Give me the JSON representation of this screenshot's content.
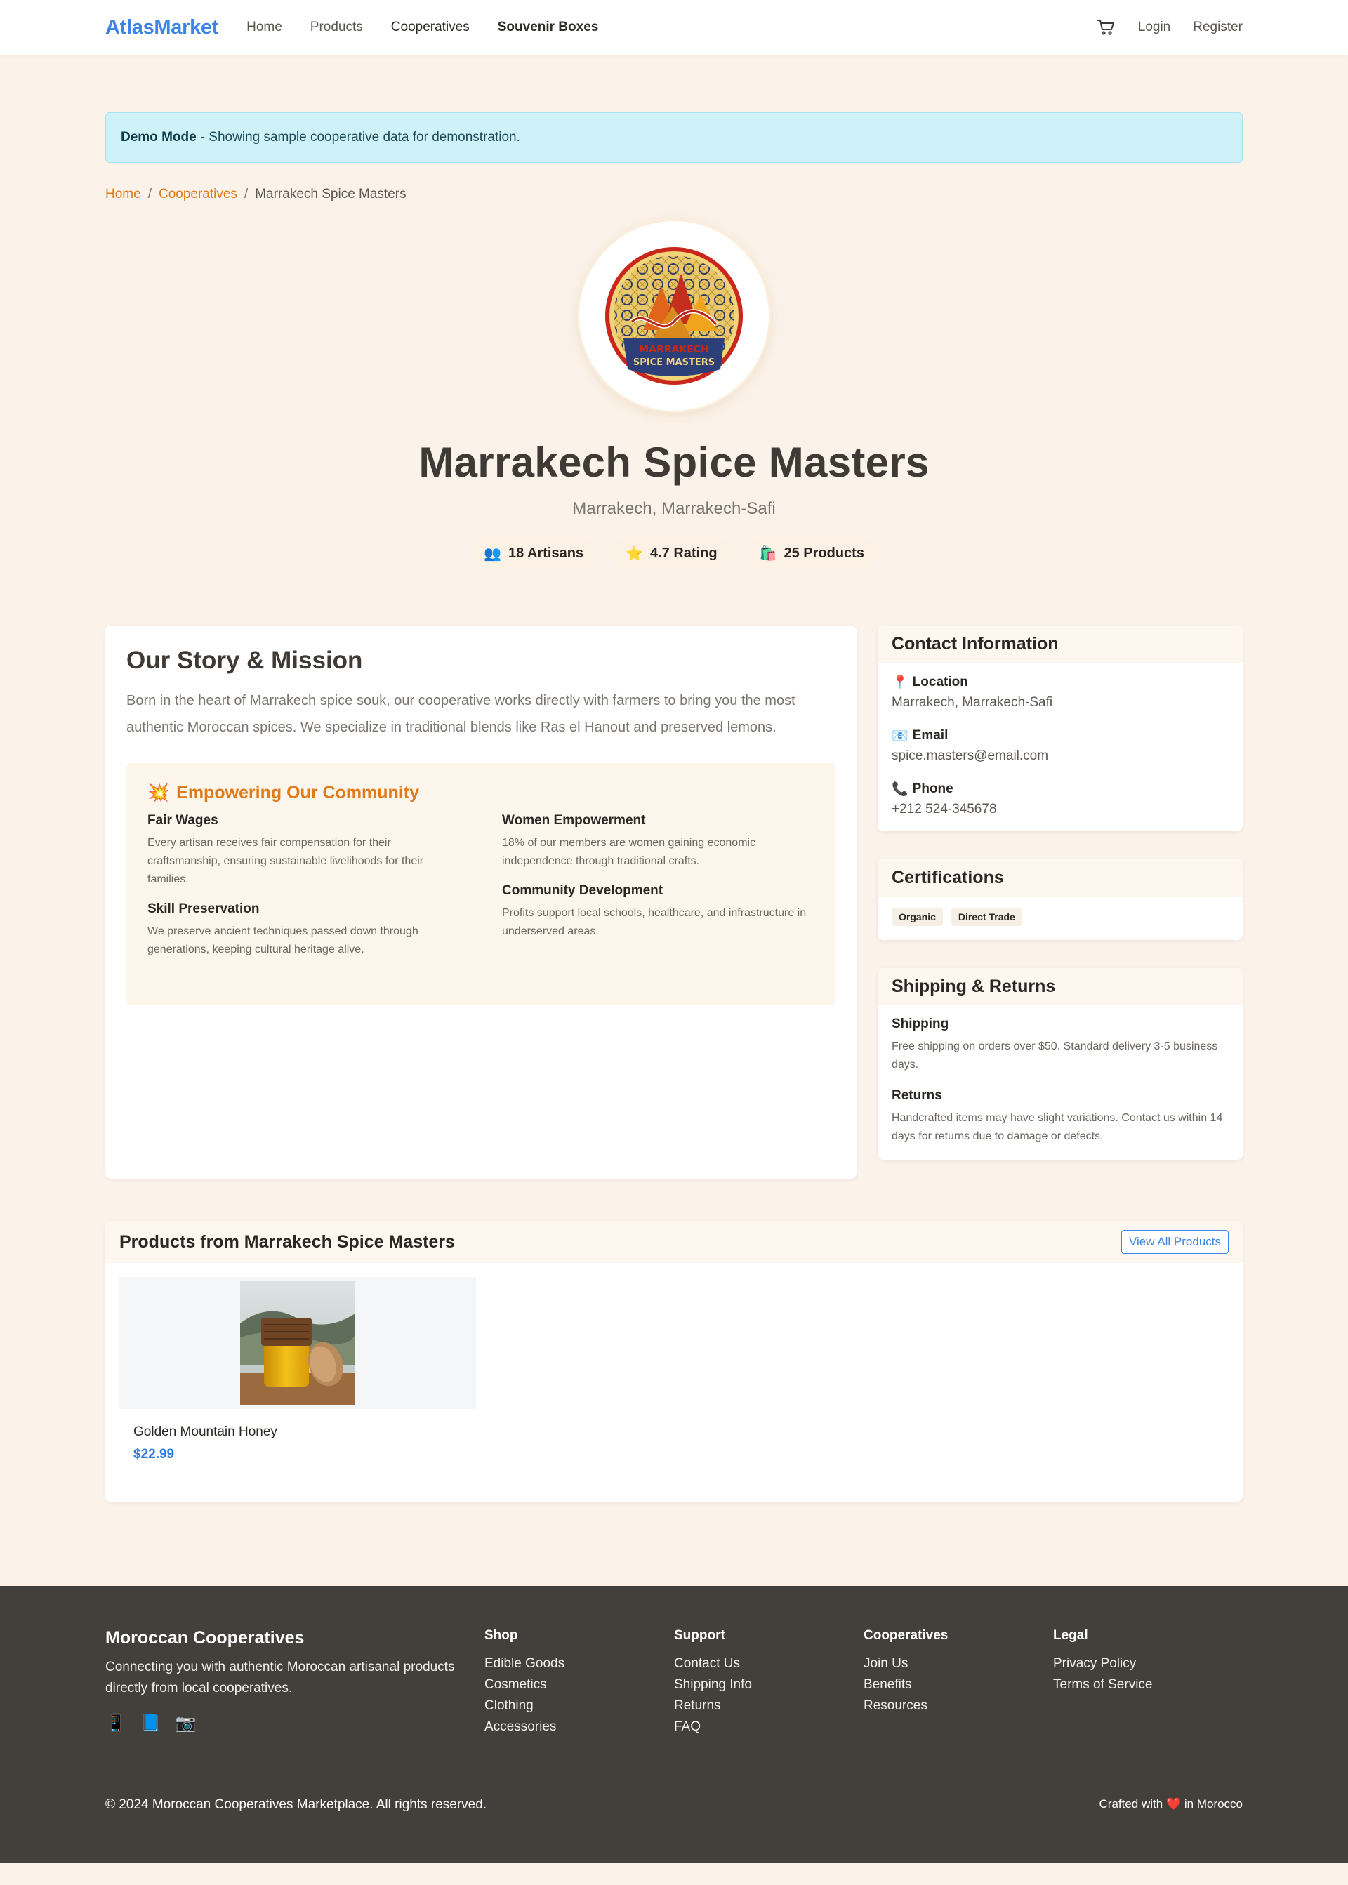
{
  "nav": {
    "brand": "AtlasMarket",
    "links": [
      "Home",
      "Products",
      "Cooperatives",
      "Souvenir Boxes"
    ],
    "login": "Login",
    "register": "Register",
    "cart_icon": "cart-icon"
  },
  "alert": {
    "title": "Demo Mode",
    "text": "- Showing sample cooperative data for demonstration."
  },
  "breadcrumb": {
    "home": "Home",
    "cooperatives": "Cooperatives",
    "current": "Marrakech Spice Masters"
  },
  "cooperative": {
    "name": "Marrakech Spice Masters",
    "location": "Marrakech, Marrakech-Safi",
    "logo_text_1": "MARRAKECH",
    "logo_text_2": "SPICE MASTERS",
    "stats": [
      {
        "icon": "👥",
        "label": "18 Artisans"
      },
      {
        "icon": "⭐",
        "label": "4.7 Rating"
      },
      {
        "icon": "🛍️",
        "label": "25 Products"
      }
    ]
  },
  "story": {
    "title": "Our Story & Mission",
    "text": "Born in the heart of Marrakech spice souk, our cooperative works directly with farmers to bring you the most authentic Moroccan spices. We specialize in traditional blends like Ras el Hanout and preserved lemons.",
    "empower_icon": "💥",
    "empower_title": "Empowering Our Community",
    "items": [
      {
        "title": "Fair Wages",
        "text": "Every artisan receives fair compensation for their craftsmanship, ensuring sustainable livelihoods for their families."
      },
      {
        "title": "Women Empowerment",
        "text": "18% of our members are women gaining economic independence through traditional crafts."
      },
      {
        "title": "Skill Preservation",
        "text": "We preserve ancient techniques passed down through generations, keeping cultural heritage alive."
      },
      {
        "title": "Community Development",
        "text": "Profits support local schools, healthcare, and infrastructure in underserved areas."
      }
    ]
  },
  "contact": {
    "title": "Contact Information",
    "location_icon": "📍",
    "location_label": "Location",
    "location_value": "Marrakech, Marrakech-Safi",
    "email_icon": "📧",
    "email_label": "Email",
    "email_value": "spice.masters@email.com",
    "phone_icon": "📞",
    "phone_label": "Phone",
    "phone_value": "+212 524-345678"
  },
  "certifications": {
    "title": "Certifications",
    "tags": [
      "Organic",
      "Direct Trade"
    ]
  },
  "shipping": {
    "title": "Shipping & Returns",
    "shipping_title": "Shipping",
    "shipping_text": "Free shipping on orders over $50. Standard delivery 3-5 business days.",
    "returns_title": "Returns",
    "returns_text": "Handcrafted items may have slight variations. Contact us within 14 days for returns due to damage or defects."
  },
  "products": {
    "title": "Products from Marrakech Spice Masters",
    "view_all": "View All Products",
    "items": [
      {
        "name": "Golden Mountain Honey",
        "price": "$22.99"
      }
    ]
  },
  "footer": {
    "brand": "Moroccan Cooperatives",
    "tagline": "Connecting you with authentic Moroccan artisanal products directly from local cooperatives.",
    "socials": [
      "📱",
      "📘",
      "📷"
    ],
    "shop_title": "Shop",
    "shop": [
      "Edible Goods",
      "Cosmetics",
      "Clothing",
      "Accessories"
    ],
    "support_title": "Support",
    "support": [
      "Contact Us",
      "Shipping Info",
      "Returns",
      "FAQ"
    ],
    "coops_title": "Cooperatives",
    "coops": [
      "Join Us",
      "Benefits",
      "Resources"
    ],
    "legal_title": "Legal",
    "legal": [
      "Privacy Policy",
      "Terms of Service"
    ],
    "copyright": "© 2024 Moroccan Cooperatives Marketplace. All rights reserved.",
    "crafted_prefix": "Crafted with",
    "crafted_heart": "❤️",
    "crafted_suffix": "in Morocco"
  }
}
